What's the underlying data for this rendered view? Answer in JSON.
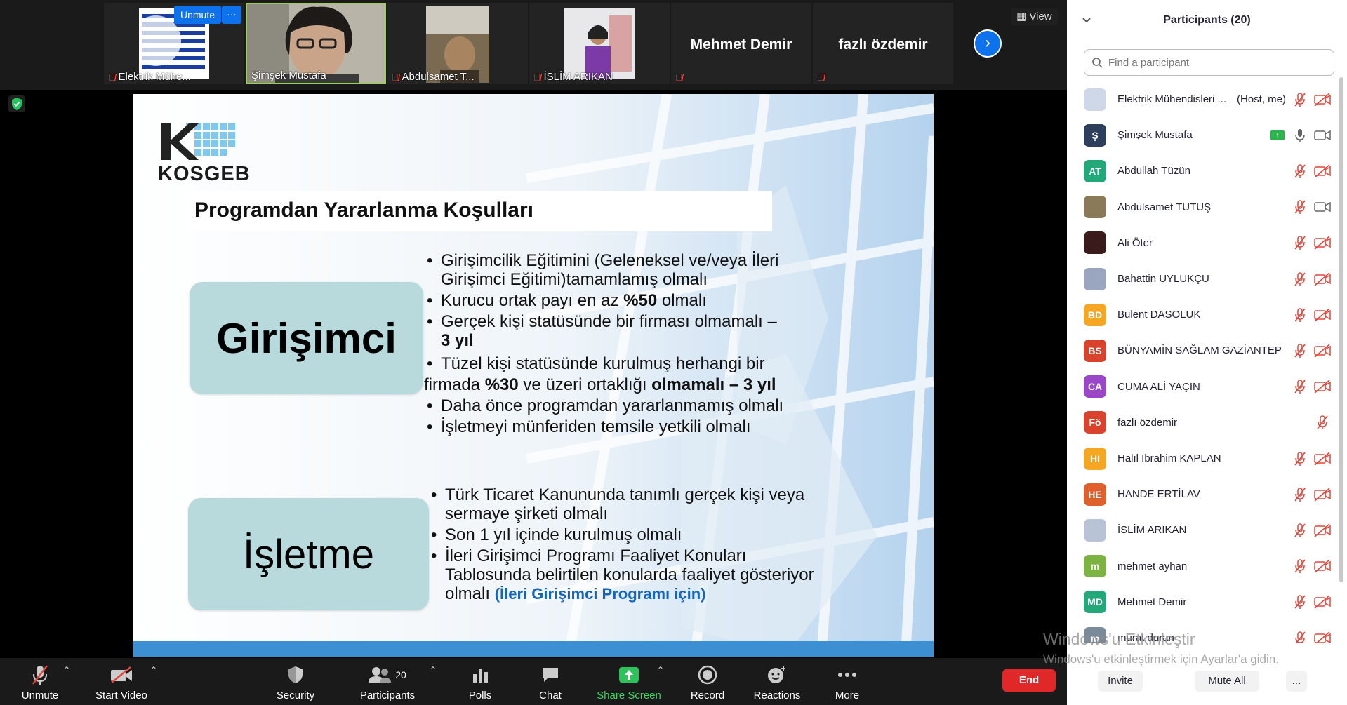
{
  "thumbnails": [
    {
      "name": "Elektrik Mühe...",
      "muted": true
    },
    {
      "name": "Şimşek Mustafa",
      "muted": false
    },
    {
      "name": "Abdulsamet T...",
      "muted": true
    },
    {
      "name": "İSLİM ARIKAN",
      "muted": true
    },
    {
      "name": "Mehmet Demir",
      "muted": true
    },
    {
      "name": "fazlı özdemir",
      "muted": true
    }
  ],
  "thumb_controls": {
    "unmute_label": "Unmute",
    "more_label": "···",
    "view_label": "View"
  },
  "slide": {
    "logo_text": "KOSGEB",
    "title": "Programdan Yararlanma Koşulları",
    "box1_label": "Girişimci",
    "box2_label": "İşletme",
    "box1_bullets": [
      "Girişimcilik Eğitimini (Geleneksel ve/veya İleri Girişimci Eğitimi)tamamlamış olmalı",
      "Kurucu ortak payı en az",
      "%50",
      "olmalı",
      "Gerçek kişi statüsünde bir firması olmamalı –",
      "3 yıl",
      "Tüzel kişi statüsünde kurulmuş herhangi bir",
      "firmada",
      "%30",
      "ve üzeri ortaklığı",
      "olmamalı – 3 yıl",
      "Daha önce programdan yararlanmamış olmalı",
      "İşletmeyi münferiden temsile yetkili olmalı"
    ],
    "box2_bullets": [
      "Türk Ticaret Kanununda tanımlı gerçek kişi veya sermaye şirketi olmalı",
      "Son 1 yıl içinde kurulmuş olmalı",
      "İleri Girişimci Programı Faaliyet Konuları Tablosunda belirtilen konularda faaliyet gösteriyor olmalı",
      "(İleri Girişimci Programı için)"
    ]
  },
  "toolbar": {
    "unmute": "Unmute",
    "start_video": "Start Video",
    "security": "Security",
    "participants": "Participants",
    "participants_count": "20",
    "polls": "Polls",
    "chat": "Chat",
    "share_screen": "Share Screen",
    "record": "Record",
    "reactions": "Reactions",
    "more": "More",
    "end": "End"
  },
  "panel": {
    "title": "Participants (20)",
    "search_placeholder": "Find a participant",
    "participants": [
      {
        "name": "Elektrik Mühendisleri ...",
        "tag": "(Host, me)",
        "initials": "",
        "color": "#cfd8e6",
        "mic": "off",
        "cam": "off"
      },
      {
        "name": "Şimşek Mustafa",
        "tag": "",
        "initials": "Ş",
        "color": "#2d3f5c",
        "mic": "on",
        "cam": "on",
        "sharing": true
      },
      {
        "name": "Abdullah Tüzün",
        "tag": "",
        "initials": "AT",
        "color": "#23a87a",
        "mic": "off",
        "cam": "off"
      },
      {
        "name": "Abdulsamet TUTUŞ",
        "tag": "",
        "initials": "",
        "color": "#8a7a5a",
        "mic": "off",
        "cam": "on"
      },
      {
        "name": "Ali Öter",
        "tag": "",
        "initials": "",
        "color": "#3a1a1a",
        "mic": "off",
        "cam": "off"
      },
      {
        "name": "Bahattin UYLUKÇU",
        "tag": "",
        "initials": "",
        "color": "#9aa6c0",
        "mic": "off",
        "cam": "off"
      },
      {
        "name": "Bulent DASOLUK",
        "tag": "",
        "initials": "BD",
        "color": "#f5a623",
        "mic": "off",
        "cam": "off"
      },
      {
        "name": "BÜNYAMİN SAĞLAM GAZİANTEP",
        "tag": "",
        "initials": "BS",
        "color": "#d9432e",
        "mic": "off",
        "cam": "off"
      },
      {
        "name": "CUMA ALİ YAÇIN",
        "tag": "",
        "initials": "CA",
        "color": "#9b45c9",
        "mic": "off",
        "cam": "off"
      },
      {
        "name": "fazlı özdemir",
        "tag": "",
        "initials": "Fö",
        "color": "#d9432e",
        "mic": "off",
        "cam": "none"
      },
      {
        "name": "Halıl Ibrahim KAPLAN",
        "tag": "",
        "initials": "HI",
        "color": "#f5a623",
        "mic": "off",
        "cam": "off"
      },
      {
        "name": "HANDE ERTİLAV",
        "tag": "",
        "initials": "HE",
        "color": "#e0602b",
        "mic": "off",
        "cam": "off"
      },
      {
        "name": "İSLİM ARIKAN",
        "tag": "",
        "initials": "",
        "color": "#b8c4d6",
        "mic": "off",
        "cam": "off"
      },
      {
        "name": "mehmet ayhan",
        "tag": "",
        "initials": "m",
        "color": "#7cb342",
        "mic": "off",
        "cam": "off"
      },
      {
        "name": "Mehmet Demir",
        "tag": "",
        "initials": "MD",
        "color": "#23a87a",
        "mic": "off",
        "cam": "off"
      },
      {
        "name": "murat duran",
        "tag": "",
        "initials": "m",
        "color": "#7a8a99",
        "mic": "off",
        "cam": "off"
      }
    ],
    "invite": "Invite",
    "mute_all": "Mute All",
    "more": "..."
  },
  "watermark": {
    "line1": "Windows'u Etkinleştir",
    "line2": "Windows'u etkinleştirmek için Ayarlar'a gidin."
  },
  "colors": {
    "accent": "#0e72ed",
    "end": "#e02828",
    "share": "#3dd55b",
    "mic_off": "#e0463b"
  }
}
